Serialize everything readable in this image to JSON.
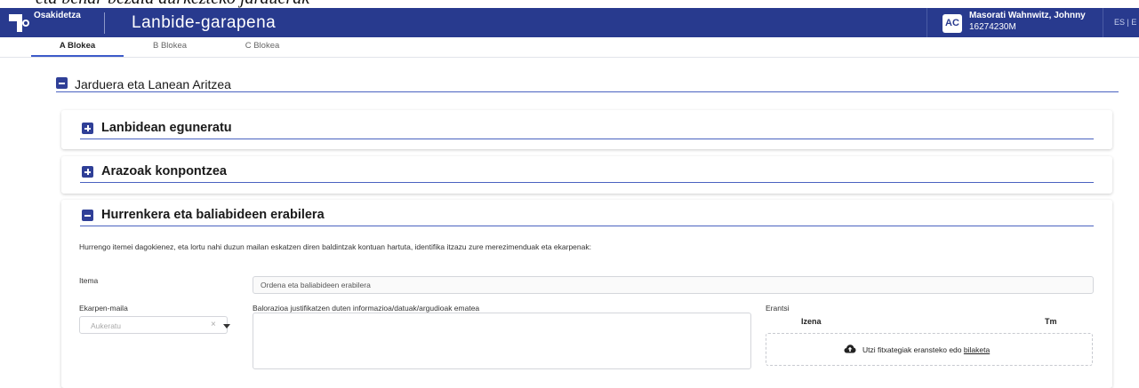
{
  "header": {
    "org_name": "Osakidetza",
    "app_title": "Lanbide-garapena",
    "user_initials": "AC",
    "user_name": "Masorati Wahnwitz, Johnny",
    "user_id": "16274230M",
    "lang": "ES | E"
  },
  "top_strip_text": "eta behar bezala aurkezteko jarduerak",
  "tabs": [
    {
      "label": "A Blokea",
      "active": true
    },
    {
      "label": "B Blokea",
      "active": false
    },
    {
      "label": "C Blokea",
      "active": false
    }
  ],
  "main_section": {
    "title": "Jarduera eta Lanean Aritzea",
    "icon": "minus-box-icon"
  },
  "cards": [
    {
      "title": "Lanbidean eguneratu",
      "icon": "plus-box-icon"
    },
    {
      "title": "Arazoak konpontzea",
      "icon": "plus-box-icon"
    },
    {
      "title": "Hurrenkera eta baliabideen erabilera",
      "icon": "minus-box-icon"
    }
  ],
  "form": {
    "intro": "Hurrengo itemei dagokienez, eta lortu nahi duzun mailan eskatzen diren baldintzak kontuan hartuta, identifika itzazu zure merezimenduak eta ekarpenak:",
    "itema_label": "Itema",
    "itema_value": "Ordena eta baliabideen erabilera",
    "ekarpen_label": "Ekarpen-maila",
    "ekarpen_placeholder": "Aukeratu",
    "clear_symbol": "×",
    "balorazioa_label": "Balorazioa justifikatzen duten informazioa/datuak/argudioak ematea",
    "erantsi_label": "Erantsi",
    "col_izena": "Izena",
    "col_tm": "Tm",
    "drop_text": "Utzi fitxategiak eransteko edo ",
    "drop_link": "bilaketa"
  },
  "colors": {
    "header_bg": "#283a8e",
    "accent": "#3d5bc9",
    "icon_box": "#2f3f97"
  }
}
